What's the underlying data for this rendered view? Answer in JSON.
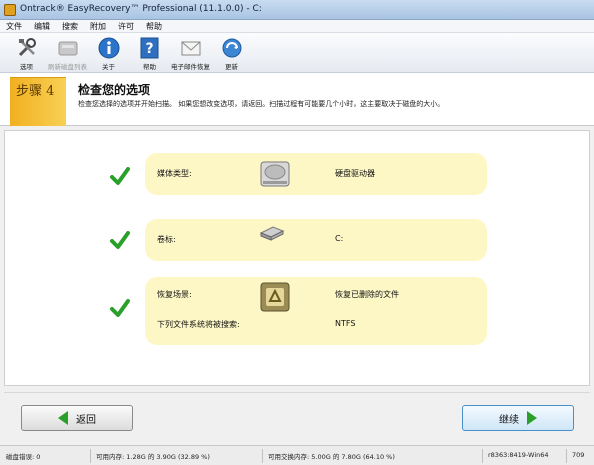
{
  "window": {
    "title": "Ontrack® EasyRecovery™ Professional (11.1.0.0) - C:"
  },
  "menu": [
    "文件",
    "编辑",
    "搜索",
    "附加",
    "许可",
    "帮助"
  ],
  "toolbar": [
    {
      "label": "选项",
      "icon": "tools-icon",
      "enabled": true
    },
    {
      "label": "刷新磁盘列表",
      "icon": "refresh-drives-icon",
      "enabled": false
    },
    {
      "label": "关于",
      "icon": "info-icon",
      "enabled": true
    },
    {
      "label": "帮助",
      "icon": "help-icon",
      "enabled": true
    },
    {
      "label": "电子邮件恢复",
      "icon": "email-icon",
      "enabled": true
    },
    {
      "label": "更新",
      "icon": "update-icon",
      "enabled": true
    }
  ],
  "step": {
    "number_label": "步骤 4",
    "title": "检查您的选项",
    "description": "检查您选择的选项并开始扫描。 如果您想改变选项，请返回。扫描过程有可能要几个小时，这主要取决于磁盘的大小。"
  },
  "options": {
    "media_type": {
      "label": "媒体类型:",
      "value": "硬盘驱动器",
      "icon": "hard-drive-icon"
    },
    "volume": {
      "label": "卷标:",
      "value": "C:",
      "icon": "volume-icon"
    },
    "recovery": {
      "scenario_label": "恢复场景:",
      "scenario_value": "恢复已删除的文件",
      "fs_label": "下列文件系统将被搜索:",
      "fs_value": "NTFS",
      "icon": "recovery-scenario-icon"
    }
  },
  "buttons": {
    "back": "返回",
    "continue": "继续"
  },
  "status": {
    "disk_errors": "磁盘错误: 0",
    "memory": "可用内存: 1.28G 的 3.90G (32.89 %)",
    "swap": "可用交换内存: 5.00G 的 7.80G (64.10 %)",
    "build": "r8363:8419-Win64",
    "code": "709"
  },
  "colors": {
    "accent": "#f1b020",
    "check_green": "#2aa02a",
    "row_bg": "#fdf7c6"
  }
}
